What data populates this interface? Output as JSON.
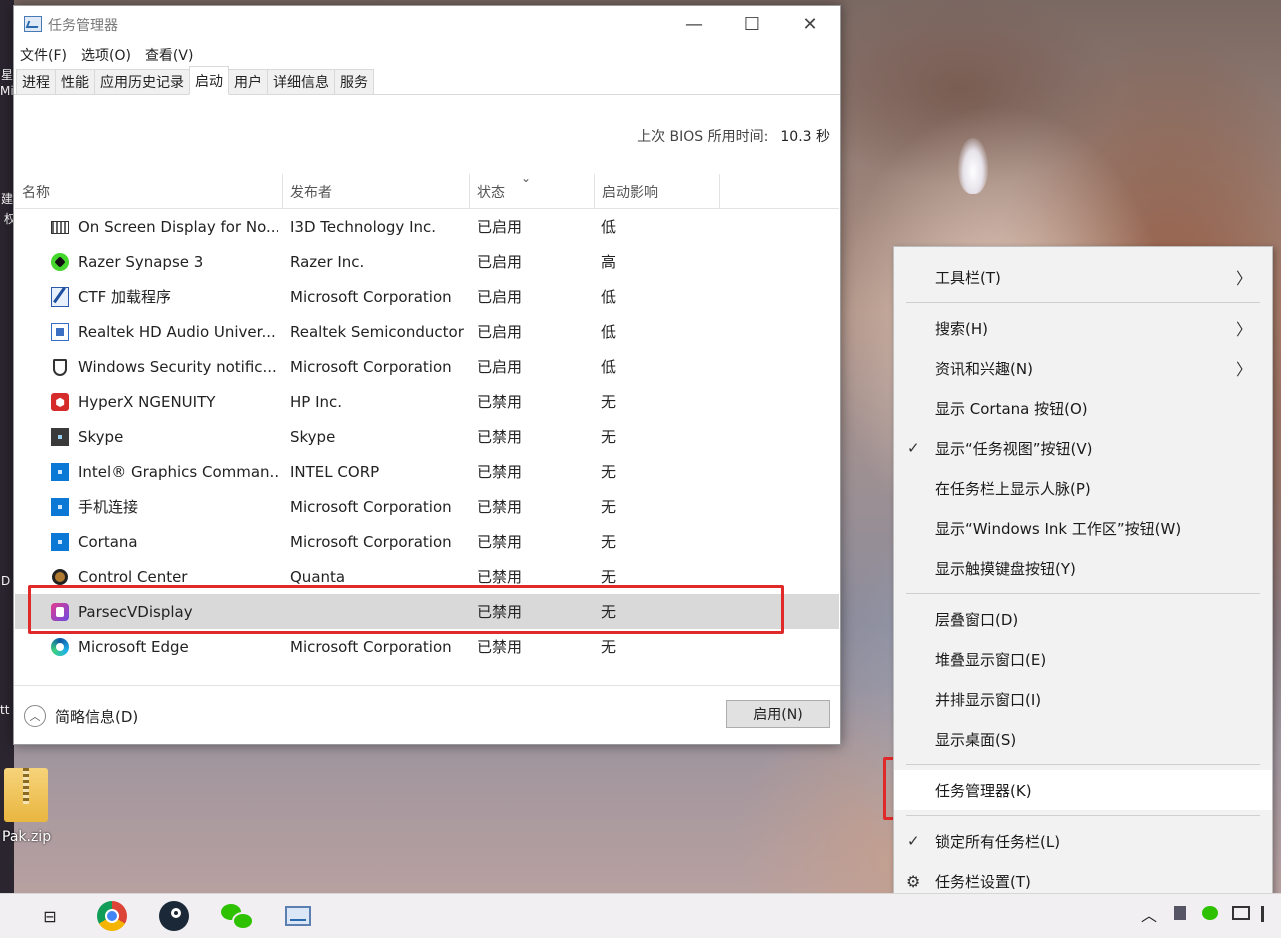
{
  "desktop": {
    "left_labels": [
      "星",
      "Mi",
      "建",
      "权",
      "D",
      "tt"
    ],
    "zip_label": "Pak.zip"
  },
  "window": {
    "title": "任务管理器",
    "controls": {
      "minimize": "—",
      "maximize": "☐",
      "close": "✕"
    },
    "menu": [
      "文件(F)",
      "选项(O)",
      "查看(V)"
    ],
    "tabs": [
      "进程",
      "性能",
      "应用历史记录",
      "启动",
      "用户",
      "详细信息",
      "服务"
    ],
    "active_tab": "启动",
    "bios_label": "上次 BIOS 所用时间:",
    "bios_value": "10.3 秒",
    "columns": {
      "name": "名称",
      "publisher": "发布者",
      "status": "状态",
      "impact": "启动影响"
    },
    "sort_indicator": "⌄",
    "rows": [
      {
        "icon": "keyboard-icon",
        "name": "On Screen Display for No...",
        "publisher": "I3D Technology Inc.",
        "status": "已启用",
        "impact": "低"
      },
      {
        "icon": "razer-icon",
        "name": "Razer Synapse 3",
        "publisher": "Razer Inc.",
        "status": "已启用",
        "impact": "高"
      },
      {
        "icon": "ctf-pen-icon",
        "name": "CTF 加载程序",
        "publisher": "Microsoft Corporation",
        "status": "已启用",
        "impact": "低"
      },
      {
        "icon": "realtek-audio-icon",
        "name": "Realtek HD Audio Univer...",
        "publisher": "Realtek Semiconductor",
        "status": "已启用",
        "impact": "低"
      },
      {
        "icon": "shield-icon",
        "name": "Windows Security notific...",
        "publisher": "Microsoft Corporation",
        "status": "已启用",
        "impact": "低"
      },
      {
        "icon": "hyperx-icon",
        "name": "HyperX NGENUITY",
        "publisher": "HP Inc.",
        "status": "已禁用",
        "impact": "无"
      },
      {
        "icon": "skype-icon",
        "name": "Skype",
        "publisher": "Skype",
        "status": "已禁用",
        "impact": "无"
      },
      {
        "icon": "intel-graphics-icon",
        "name": "Intel® Graphics Comman...",
        "publisher": "INTEL CORP",
        "status": "已禁用",
        "impact": "无"
      },
      {
        "icon": "phone-link-icon",
        "name": "手机连接",
        "publisher": "Microsoft Corporation",
        "status": "已禁用",
        "impact": "无"
      },
      {
        "icon": "cortana-icon",
        "name": "Cortana",
        "publisher": "Microsoft Corporation",
        "status": "已禁用",
        "impact": "无"
      },
      {
        "icon": "control-center-icon",
        "name": "Control Center",
        "publisher": "Quanta",
        "status": "已禁用",
        "impact": "无"
      },
      {
        "icon": "parsec-icon",
        "name": "ParsecVDisplay",
        "publisher": "",
        "status": "已禁用",
        "impact": "无"
      },
      {
        "icon": "edge-icon",
        "name": "Microsoft Edge",
        "publisher": "Microsoft Corporation",
        "status": "已禁用",
        "impact": "无"
      }
    ],
    "selected_row": "ParsecVDisplay",
    "footer": {
      "collapse_glyph": "︿",
      "brief_label": "简略信息(D)",
      "enable_button": "启用(N)"
    }
  },
  "context_menu": {
    "items": [
      {
        "label": "工具栏(T)",
        "submenu": true
      },
      {
        "label": "搜索(H)",
        "submenu": true
      },
      {
        "label": "资讯和兴趣(N)",
        "submenu": true
      },
      {
        "label": "显示 Cortana 按钮(O)"
      },
      {
        "label": "显示“任务视图”按钮(V)",
        "checked": true
      },
      {
        "label": "在任务栏上显示人脉(P)"
      },
      {
        "label": "显示“Windows Ink 工作区”按钮(W)"
      },
      {
        "label": "显示触摸键盘按钮(Y)"
      },
      {
        "label": "层叠窗口(D)"
      },
      {
        "label": "堆叠显示窗口(E)"
      },
      {
        "label": "并排显示窗口(I)"
      },
      {
        "label": "显示桌面(S)"
      },
      {
        "label": "任务管理器(K)",
        "highlighted": true
      },
      {
        "label": "锁定所有任务栏(L)",
        "checked": true
      },
      {
        "label": "任务栏设置(T)",
        "icon": "gear-icon"
      }
    ],
    "chevron": "〉",
    "check": "✓",
    "gear": "⚙"
  },
  "taskbar": {
    "task_view_glyph": "⊟",
    "apps": [
      "chrome-icon",
      "steam-icon",
      "wechat-icon",
      "task-manager-icon"
    ],
    "tray": {
      "chevron": "︿"
    }
  },
  "colors": {
    "highlight_box": "#e02a2a",
    "selected_row": "#d9d9d9",
    "menu_bg": "#f2f2f2"
  }
}
